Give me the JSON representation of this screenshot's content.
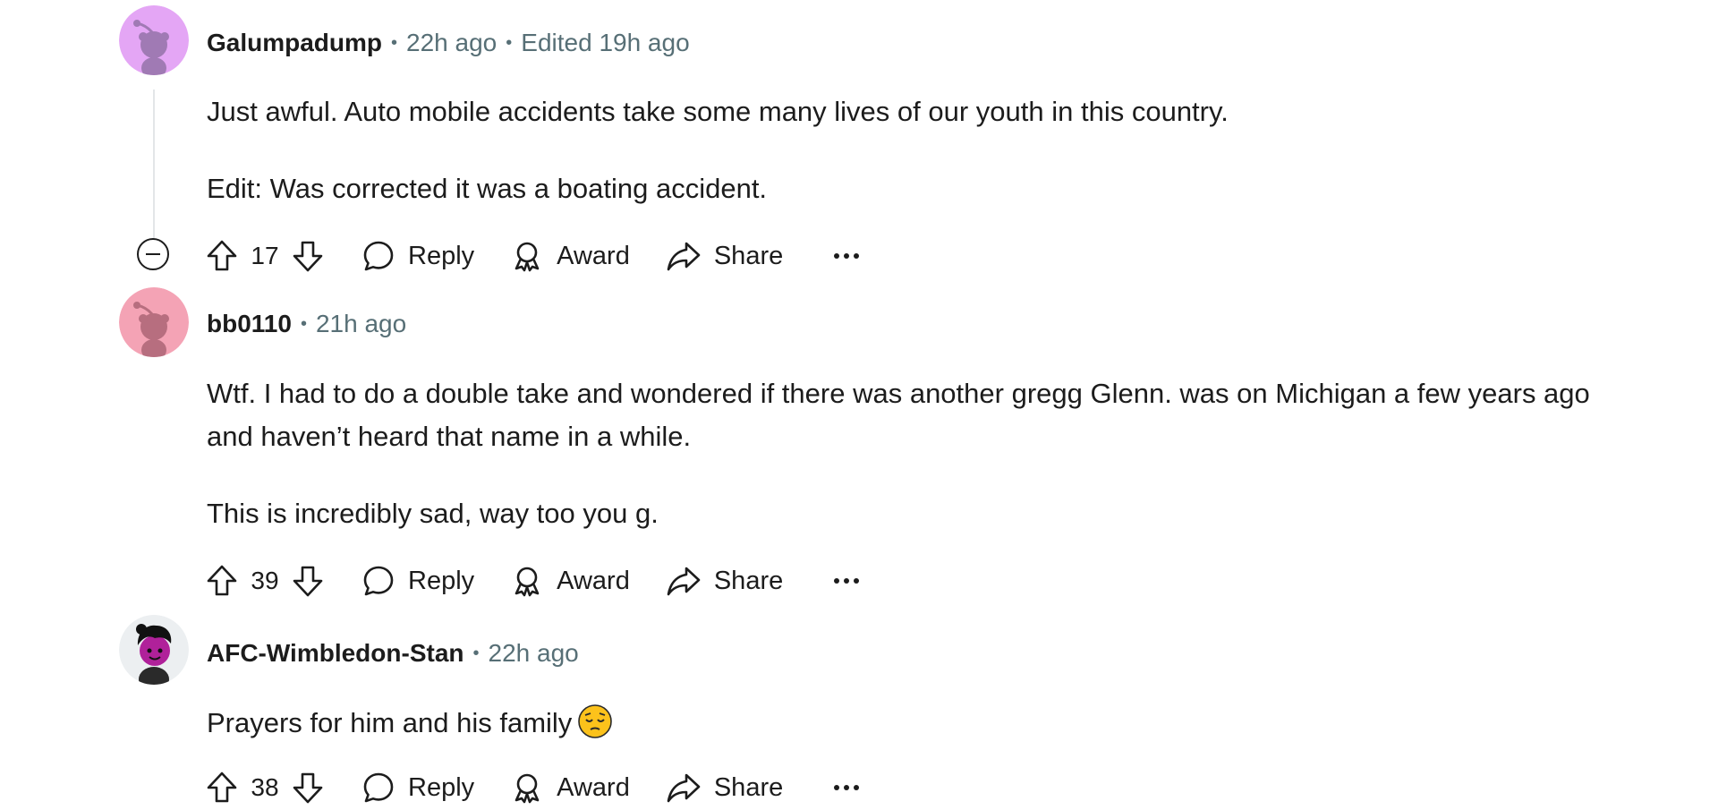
{
  "comments": [
    {
      "username": "Galumpadump",
      "time": "22h ago",
      "edited": "Edited 19h ago",
      "paragraphs": [
        "Just awful. Auto mobile accidents take some many lives of our youth in this country.",
        "Edit: Was corrected it was a boating accident."
      ],
      "score": "17",
      "avatar_color": "#e4a6f5",
      "actions": {
        "reply": "Reply",
        "award": "Award",
        "share": "Share"
      }
    },
    {
      "username": "bb0110",
      "time": "21h ago",
      "paragraphs": [
        "Wtf. I had to do a double take and wondered if there was another gregg Glenn. was on Michigan a few years ago and haven’t heard that name in a while.",
        "This is incredibly sad, way too you g."
      ],
      "score": "39",
      "avatar_color": "#f4a3b5",
      "actions": {
        "reply": "Reply",
        "award": "Award",
        "share": "Share"
      }
    },
    {
      "username": "AFC-Wimbledon-Stan",
      "time": "22h ago",
      "paragraphs": [
        "Prayers for him and his family"
      ],
      "emoji": "pensive-face-emoji",
      "score": "38",
      "avatar_color": "#eceff1",
      "actions": {
        "reply": "Reply",
        "award": "Award",
        "share": "Share"
      }
    }
  ],
  "icons": {
    "upvote": "upvote-icon",
    "downvote": "downvote-icon",
    "reply": "comment-bubble-icon",
    "award": "award-ribbon-icon",
    "share": "share-arrow-icon",
    "more": "ellipsis-icon",
    "collapse": "collapse-minus-icon"
  }
}
